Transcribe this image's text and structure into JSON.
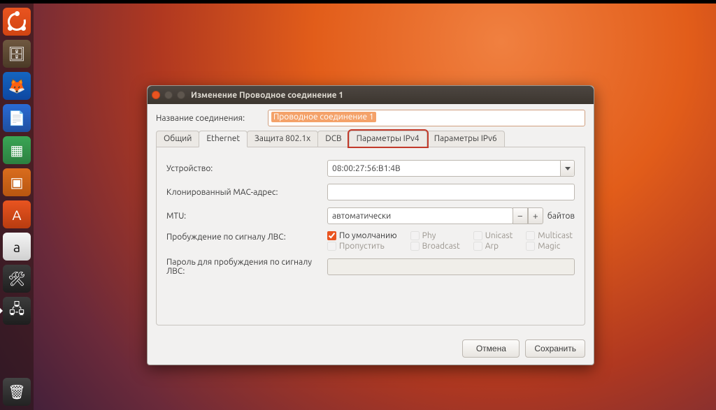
{
  "launcher": {
    "items": [
      {
        "id": "ubuntu",
        "glyph": ""
      },
      {
        "id": "files",
        "glyph": "🗄"
      },
      {
        "id": "firefox",
        "glyph": "🦊"
      },
      {
        "id": "writer",
        "glyph": "📄"
      },
      {
        "id": "calc",
        "glyph": "▦"
      },
      {
        "id": "impress",
        "glyph": "▣"
      },
      {
        "id": "software",
        "glyph": "A"
      },
      {
        "id": "amazon",
        "glyph": "a"
      },
      {
        "id": "settings",
        "glyph": "🛠"
      },
      {
        "id": "network",
        "glyph": "🖧"
      }
    ],
    "trash_glyph": "🗑"
  },
  "dialog": {
    "title": "Изменение Проводное соединение 1",
    "connection_name_label": "Название соединения:",
    "connection_name_value": "Проводное соединение 1",
    "tabs": {
      "general": "Общий",
      "ethernet": "Ethernet",
      "security": "Защита 802.1x",
      "dcb": "DCB",
      "ipv4": "Параметры IPv4",
      "ipv6": "Параметры IPv6"
    },
    "ethernet": {
      "device_label": "Устройство:",
      "device_value": "08:00:27:56:B1:4B",
      "cloned_mac_label": "Клонированный MAC-адрес:",
      "cloned_mac_value": "",
      "mtu_label": "MTU:",
      "mtu_value": "автоматически",
      "mtu_unit": "байтов",
      "wol_label": "Пробуждение по сигналу ЛВС:",
      "wol_password_label": "Пароль для пробуждения по сигналу ЛВС:",
      "wol_password_value": "",
      "wol_options": {
        "default": "По умолчанию",
        "phy": "Phy",
        "unicast": "Unicast",
        "multicast": "Multicast",
        "skip": "Пропустить",
        "broadcast": "Broadcast",
        "arp": "Arp",
        "magic": "Magic"
      }
    },
    "buttons": {
      "cancel": "Отмена",
      "save": "Сохранить"
    }
  }
}
